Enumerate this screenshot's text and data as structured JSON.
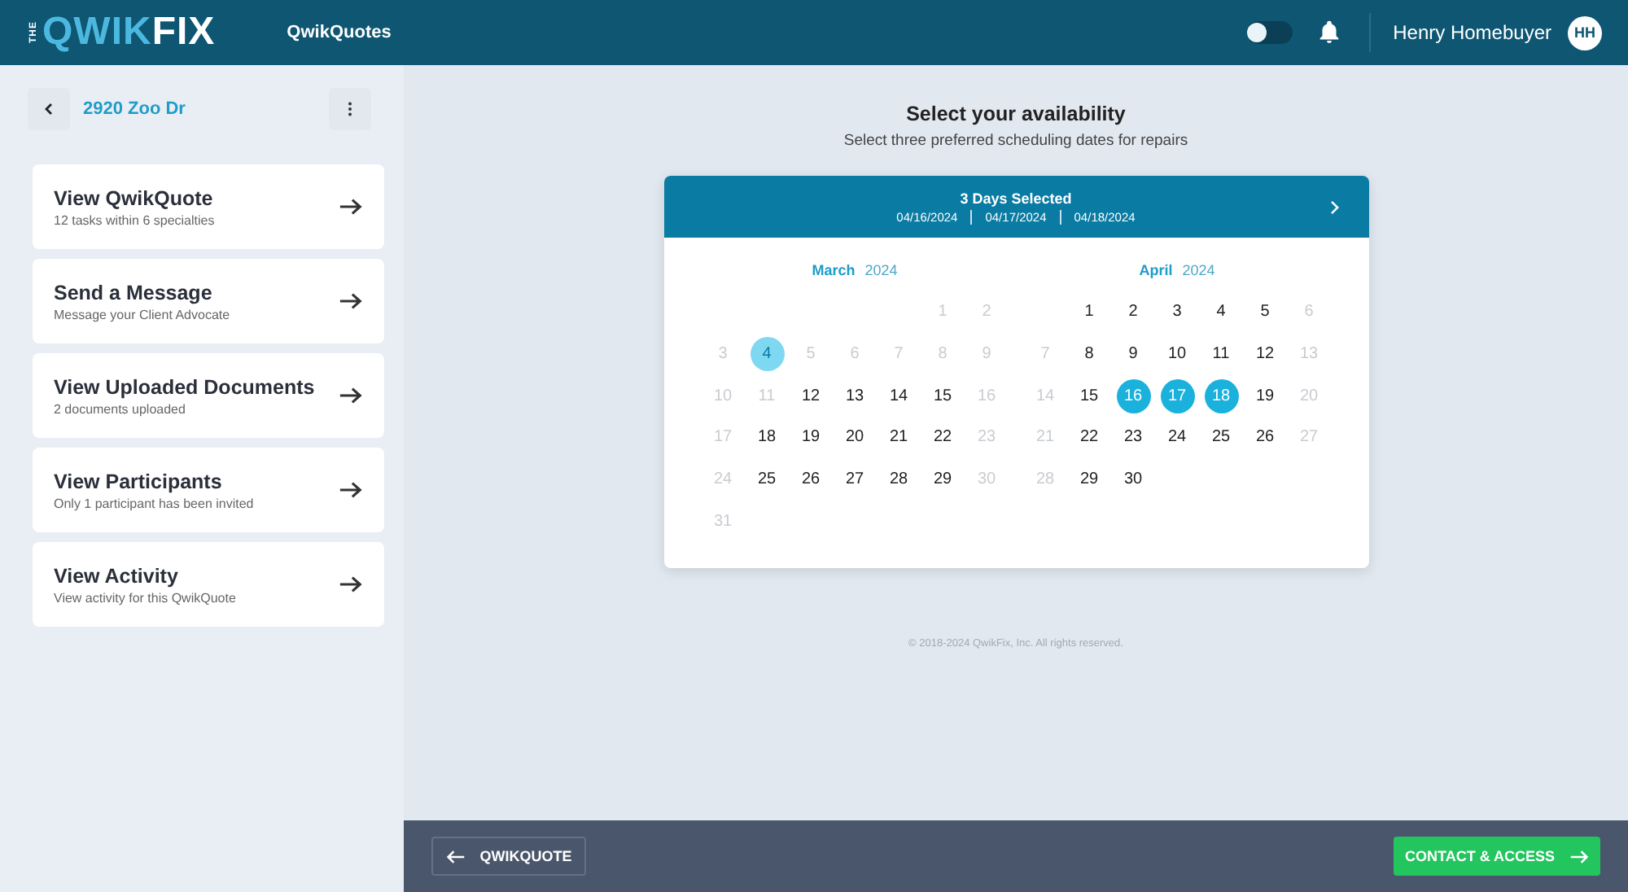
{
  "header": {
    "logo": {
      "prefix": "THE",
      "part1": "QWIK",
      "part2": "FIX"
    },
    "nav_link": "QwikQuotes",
    "theme_toggle": {
      "on": false
    },
    "user_name": "Henry Homebuyer",
    "avatar_initials": "HH"
  },
  "sidebar": {
    "title": "2920 Zoo Dr",
    "items": [
      {
        "title": "View QwikQuote",
        "subtitle": "12 tasks within 6 specialties"
      },
      {
        "title": "Send a Message",
        "subtitle": "Message your Client Advocate"
      },
      {
        "title": "View Uploaded Documents",
        "subtitle": "2 documents uploaded"
      },
      {
        "title": "View Participants",
        "subtitle": "Only 1 participant has been invited"
      },
      {
        "title": "View Activity",
        "subtitle": "View activity for this QwikQuote"
      }
    ]
  },
  "main": {
    "heading": "Select your availability",
    "subheading": "Select three preferred scheduling dates for repairs",
    "calendar": {
      "summary": "3 Days Selected",
      "selected_dates": [
        "04/16/2024",
        "04/17/2024",
        "04/18/2024"
      ],
      "months": [
        {
          "name": "March",
          "year": "2024",
          "weeks": [
            {
              "kind": "first_week",
              "days": [
                {
                  "day": "1",
                  "disabled": true,
                  "selected": false
                },
                {
                  "day": "2",
                  "disabled": true,
                  "selected": false
                }
              ]
            },
            {
              "kind": "week",
              "days": [
                {
                  "day": "3",
                  "disabled": true,
                  "selected": false
                },
                {
                  "day": "4",
                  "disabled": false,
                  "selected": false,
                  "today": true
                },
                {
                  "day": "5",
                  "disabled": true,
                  "selected": false
                },
                {
                  "day": "6",
                  "disabled": true,
                  "selected": false
                },
                {
                  "day": "7",
                  "disabled": true,
                  "selected": false
                },
                {
                  "day": "8",
                  "disabled": true,
                  "selected": false
                },
                {
                  "day": "9",
                  "disabled": true,
                  "selected": false
                }
              ]
            },
            {
              "kind": "week",
              "days": [
                {
                  "day": "10",
                  "disabled": true,
                  "selected": false
                },
                {
                  "day": "11",
                  "disabled": true,
                  "selected": false
                },
                {
                  "day": "12",
                  "disabled": false,
                  "selected": false
                },
                {
                  "day": "13",
                  "disabled": false,
                  "selected": false
                },
                {
                  "day": "14",
                  "disabled": false,
                  "selected": false
                },
                {
                  "day": "15",
                  "disabled": false,
                  "selected": false
                },
                {
                  "day": "16",
                  "disabled": true,
                  "selected": false
                }
              ]
            },
            {
              "kind": "week",
              "days": [
                {
                  "day": "17",
                  "disabled": true,
                  "selected": false
                },
                {
                  "day": "18",
                  "disabled": false,
                  "selected": false
                },
                {
                  "day": "19",
                  "disabled": false,
                  "selected": false
                },
                {
                  "day": "20",
                  "disabled": false,
                  "selected": false
                },
                {
                  "day": "21",
                  "disabled": false,
                  "selected": false
                },
                {
                  "day": "22",
                  "disabled": false,
                  "selected": false
                },
                {
                  "day": "23",
                  "disabled": true,
                  "selected": false
                }
              ]
            },
            {
              "kind": "week",
              "days": [
                {
                  "day": "24",
                  "disabled": true,
                  "selected": false
                },
                {
                  "day": "25",
                  "disabled": false,
                  "selected": false
                },
                {
                  "day": "26",
                  "disabled": false,
                  "selected": false
                },
                {
                  "day": "27",
                  "disabled": false,
                  "selected": false
                },
                {
                  "day": "28",
                  "disabled": false,
                  "selected": false
                },
                {
                  "day": "29",
                  "disabled": false,
                  "selected": false
                },
                {
                  "day": "30",
                  "disabled": true,
                  "selected": false
                }
              ]
            },
            {
              "kind": "week",
              "days": [
                {
                  "day": "31",
                  "disabled": true,
                  "selected": false
                }
              ]
            }
          ]
        },
        {
          "name": "April",
          "year": "2024",
          "weeks": [
            {
              "kind": "first_week",
              "days": [
                {
                  "day": "1",
                  "disabled": false,
                  "selected": false
                },
                {
                  "day": "2",
                  "disabled": false,
                  "selected": false
                },
                {
                  "day": "3",
                  "disabled": false,
                  "selected": false
                },
                {
                  "day": "4",
                  "disabled": false,
                  "selected": false
                },
                {
                  "day": "5",
                  "disabled": false,
                  "selected": false
                },
                {
                  "day": "6",
                  "disabled": true,
                  "selected": false
                }
              ]
            },
            {
              "kind": "week",
              "days": [
                {
                  "day": "7",
                  "disabled": true,
                  "selected": false
                },
                {
                  "day": "8",
                  "disabled": false,
                  "selected": false
                },
                {
                  "day": "9",
                  "disabled": false,
                  "selected": false
                },
                {
                  "day": "10",
                  "disabled": false,
                  "selected": false
                },
                {
                  "day": "11",
                  "disabled": false,
                  "selected": false
                },
                {
                  "day": "12",
                  "disabled": false,
                  "selected": false
                },
                {
                  "day": "13",
                  "disabled": true,
                  "selected": false
                }
              ]
            },
            {
              "kind": "week",
              "days": [
                {
                  "day": "14",
                  "disabled": true,
                  "selected": false
                },
                {
                  "day": "15",
                  "disabled": false,
                  "selected": false
                },
                {
                  "day": "16",
                  "disabled": false,
                  "selected": true
                },
                {
                  "day": "17",
                  "disabled": false,
                  "selected": true
                },
                {
                  "day": "18",
                  "disabled": false,
                  "selected": true
                },
                {
                  "day": "19",
                  "disabled": false,
                  "selected": false
                },
                {
                  "day": "20",
                  "disabled": true,
                  "selected": false
                }
              ]
            },
            {
              "kind": "week",
              "days": [
                {
                  "day": "21",
                  "disabled": true,
                  "selected": false
                },
                {
                  "day": "22",
                  "disabled": false,
                  "selected": false
                },
                {
                  "day": "23",
                  "disabled": false,
                  "selected": false
                },
                {
                  "day": "24",
                  "disabled": false,
                  "selected": false
                },
                {
                  "day": "25",
                  "disabled": false,
                  "selected": false
                },
                {
                  "day": "26",
                  "disabled": false,
                  "selected": false
                },
                {
                  "day": "27",
                  "disabled": true,
                  "selected": false
                }
              ]
            },
            {
              "kind": "week",
              "days": [
                {
                  "day": "28",
                  "disabled": true,
                  "selected": false
                },
                {
                  "day": "29",
                  "disabled": false,
                  "selected": false
                },
                {
                  "day": "30",
                  "disabled": false,
                  "selected": false
                }
              ]
            }
          ]
        }
      ]
    },
    "copyright": "© 2018-2024 QwikFix, Inc. All rights reserved."
  },
  "footer": {
    "back_button": "QWIKQUOTE",
    "next_button": "CONTACT & ACCESS"
  }
}
